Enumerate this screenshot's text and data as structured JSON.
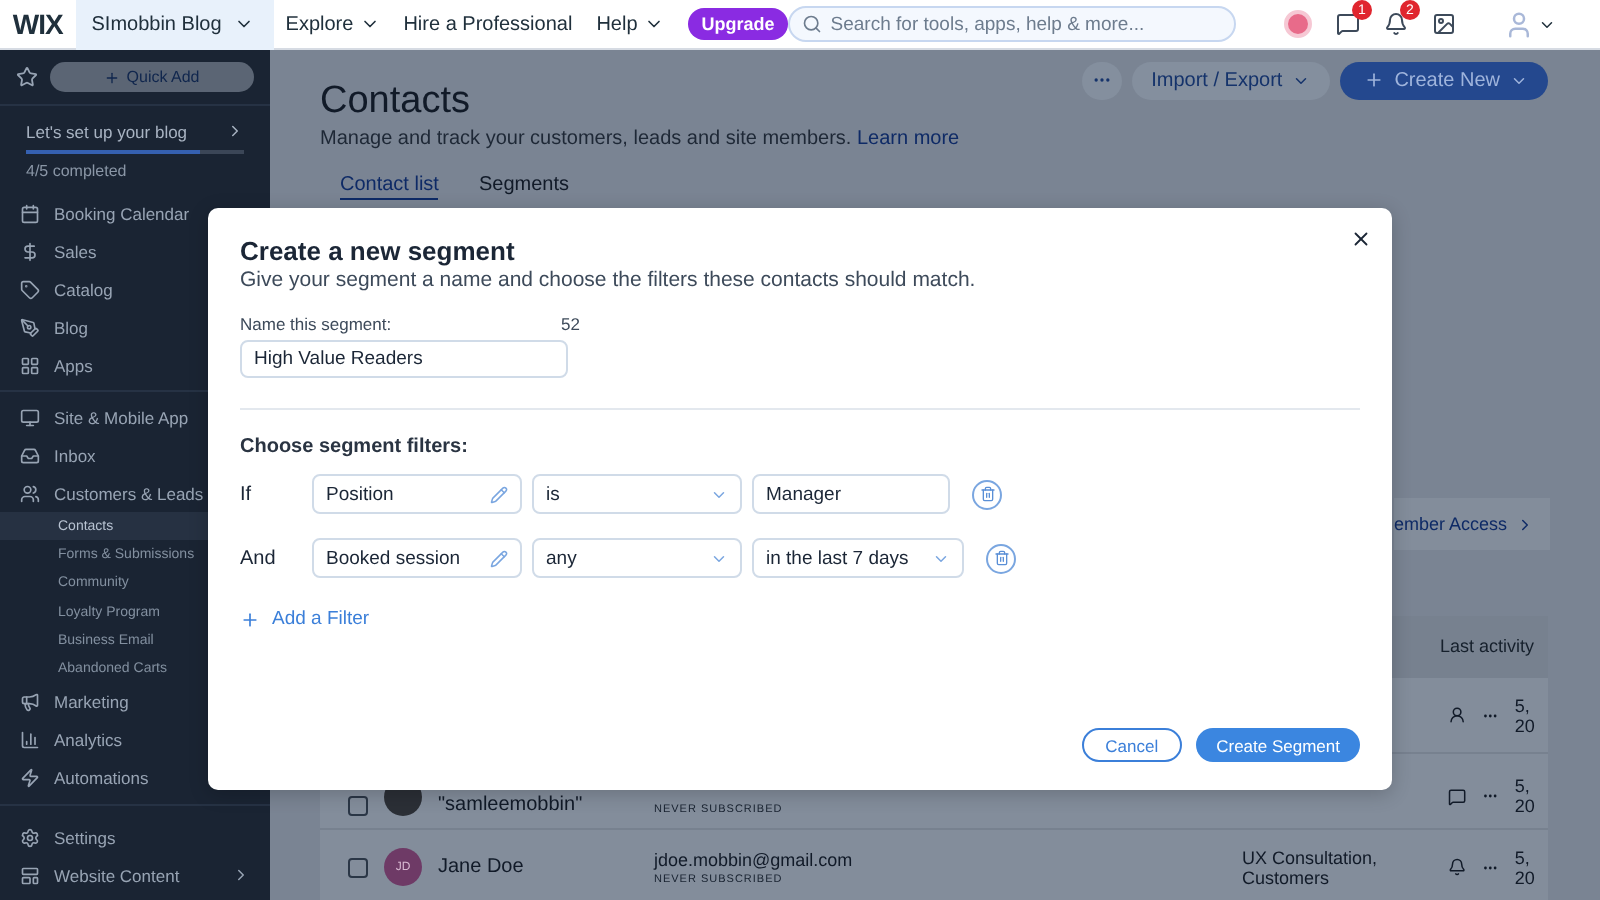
{
  "topbar": {
    "logo": "WIX",
    "site": "SImobbin Blog",
    "menu": [
      {
        "label": "Explore",
        "dropdown": true
      },
      {
        "label": "Hire a Professional",
        "dropdown": false
      },
      {
        "label": "Help",
        "dropdown": true
      }
    ],
    "upgrade": "Upgrade",
    "search": {
      "placeholder": "Search for tools, apps, help & more..."
    },
    "badges": {
      "chat": "1",
      "notifications": "2"
    }
  },
  "sidebar": {
    "quick_add": "Quick Add",
    "setup": {
      "title": "Let's set up your blog",
      "level": 0.8,
      "progress": "4/5 completed"
    },
    "groups": [
      [
        {
          "label": "Booking Calendar"
        },
        {
          "label": "Sales"
        },
        {
          "label": "Catalog"
        },
        {
          "label": "Blog"
        },
        {
          "label": "Apps"
        }
      ],
      [
        {
          "label": "Site & Mobile App"
        },
        {
          "label": "Inbox"
        },
        {
          "label": "Customers & Leads",
          "children": [
            {
              "label": "Contacts",
              "selected": true
            },
            {
              "label": "Forms & Submissions",
              "selected": false
            },
            {
              "label": "Community",
              "selected": false
            },
            {
              "label": "Loyalty Program",
              "selected": false
            },
            {
              "label": "Business Email",
              "selected": false
            },
            {
              "label": "Abandoned Carts",
              "selected": false
            }
          ]
        },
        {
          "label": "Marketing"
        },
        {
          "label": "Analytics"
        },
        {
          "label": "Automations"
        }
      ],
      [
        {
          "label": "Settings",
          "chevron": false
        },
        {
          "label": "Website Content",
          "chevron": true
        }
      ]
    ]
  },
  "page": {
    "title": "Contacts",
    "subtitle": "Manage and track your customers, leads and site members.",
    "learn_more": "Learn more",
    "import_export": "Import / Export",
    "create_new": "Create New",
    "tabs": [
      {
        "label": "Contact list",
        "selected": true
      },
      {
        "label": "Segments",
        "selected": false
      }
    ],
    "member_access": "ember Access",
    "table": {
      "last_activity_header": "Last activity",
      "rows": [
        {
          "last_activity": "5, 20"
        },
        {
          "checked": false,
          "name": "\"samleemobbin\"",
          "status": "NEVER SUBSCRIBED",
          "last_activity": "5, 20"
        },
        {
          "checked": false,
          "name": "Jane Doe",
          "email": "jdoe.mobbin@gmail.com",
          "status": "NEVER SUBSCRIBED",
          "initials": "JD",
          "labels": "UX Consultation, Customers",
          "last_activity": "5, 20"
        }
      ]
    }
  },
  "modal": {
    "title": "Create a new segment",
    "subtitle": "Give your segment a name and choose the filters these contacts should match.",
    "name_label": "Name this segment:",
    "char_count": "52",
    "name_value": "High Value Readers",
    "filters_title": "Choose segment filters:",
    "filters": [
      {
        "connector": "If",
        "field": "Position",
        "operator": "is",
        "value": "Manager",
        "kind": "text"
      },
      {
        "connector": "And",
        "field": "Booked session",
        "operator": "any",
        "value": "in the last 7 days",
        "kind": "select"
      }
    ],
    "add_filter": "Add a Filter",
    "cancel": "Cancel",
    "submit": "Create Segment"
  }
}
